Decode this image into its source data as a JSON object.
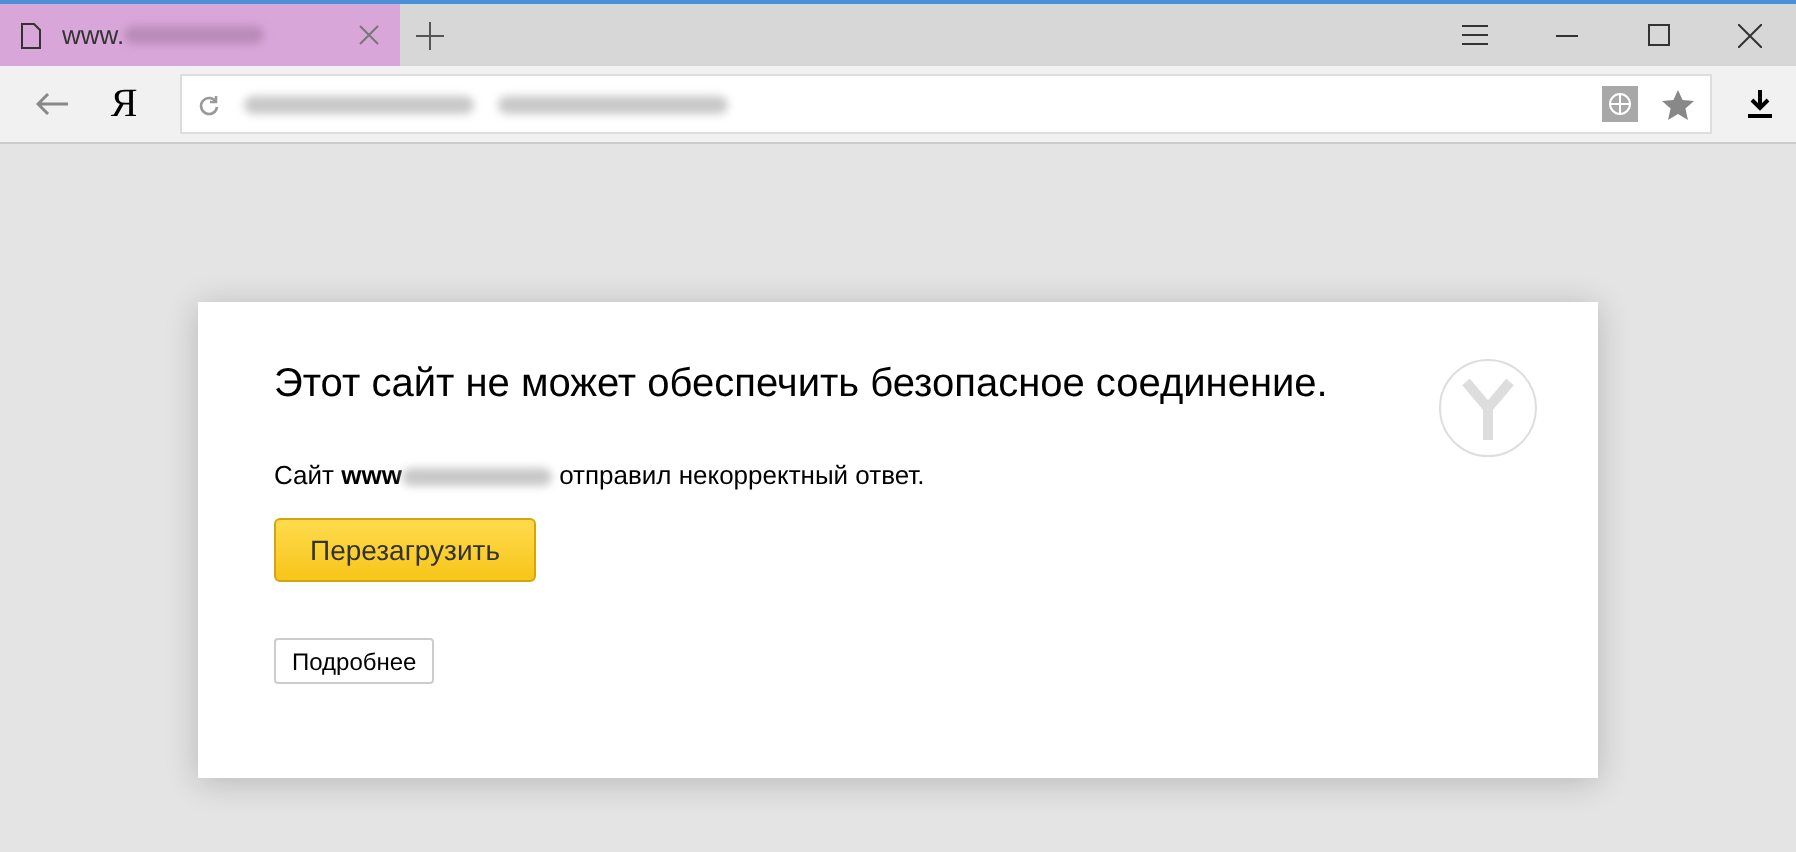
{
  "tabs": [
    {
      "title": "www.",
      "selected": true
    }
  ],
  "toolbar": {
    "logo": "Я"
  },
  "error": {
    "title": "Этот сайт не может обеспечить безопасное соединение.",
    "message_before": "Сайт **www**",
    "message_after": "отправил некорректный ответ.",
    "reload_button": "Перезагрузить",
    "details_button": "Подробнее"
  }
}
